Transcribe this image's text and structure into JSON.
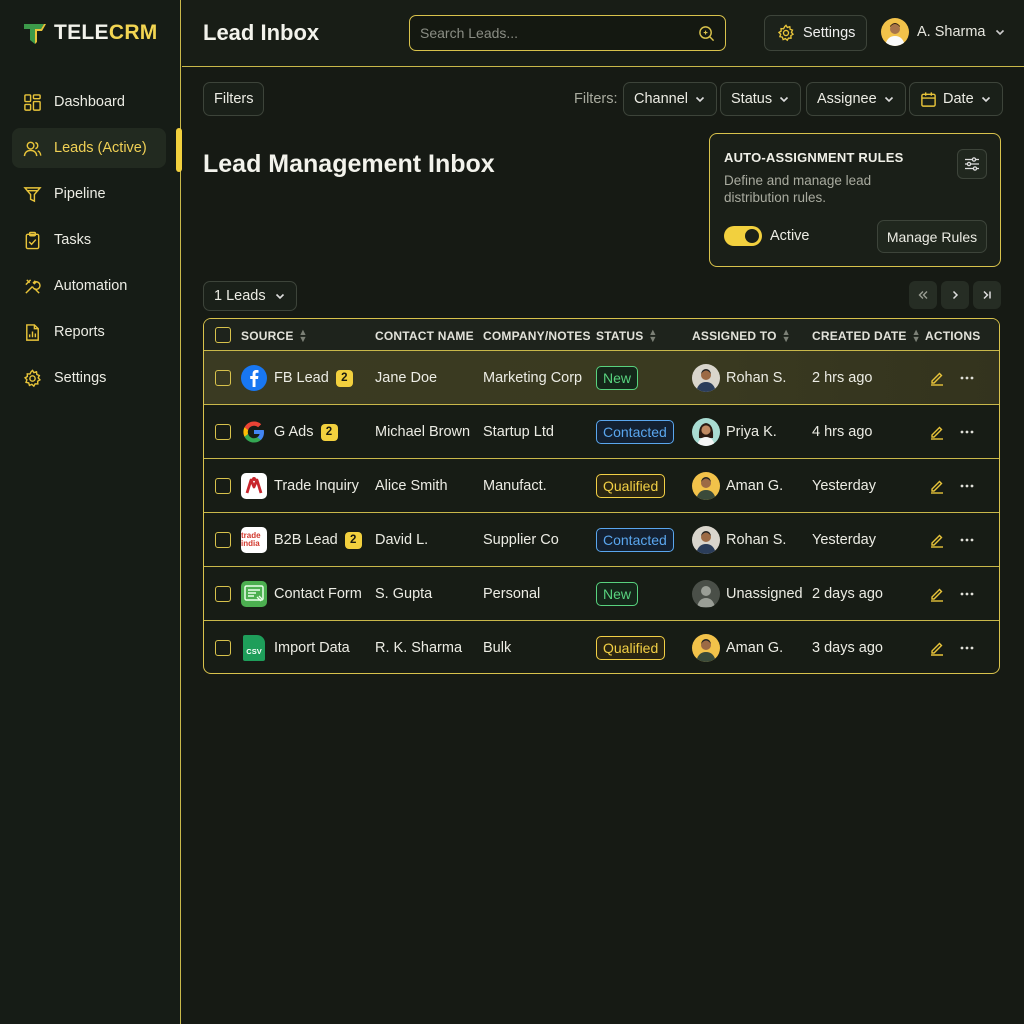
{
  "app": {
    "logo_part1": "TELE",
    "logo_part2": "CRM"
  },
  "sidebar": {
    "items": [
      {
        "label": "Dashboard",
        "icon": "grid-icon"
      },
      {
        "label": "Leads (Active)",
        "icon": "users-icon",
        "active": true
      },
      {
        "label": "Pipeline",
        "icon": "funnel-icon"
      },
      {
        "label": "Tasks",
        "icon": "clipboard-check-icon"
      },
      {
        "label": "Automation",
        "icon": "tools-icon"
      },
      {
        "label": "Reports",
        "icon": "report-chart-icon"
      },
      {
        "label": "Settings",
        "icon": "gear-icon"
      }
    ]
  },
  "header": {
    "title": "Lead Inbox",
    "search_placeholder": "Search Leads...",
    "settings_label": "Settings",
    "user_name": "A. Sharma"
  },
  "filters": {
    "button_label": "Filters",
    "label": "Filters:",
    "channel": "Channel",
    "status": "Status",
    "assignee": "Assignee",
    "date": "Date"
  },
  "main": {
    "heading": "Lead Management Inbox",
    "lead_count": "1 Leads"
  },
  "rules": {
    "title": "AUTO-ASSIGNMENT RULES",
    "description": "Define and manage lead distribution rules.",
    "toggle_label": "Active",
    "toggle_on": true,
    "manage_label": "Manage Rules"
  },
  "table": {
    "columns": [
      "SOURCE",
      "CONTACT NAME",
      "COMPANY/NOTES",
      "STATUS",
      "ASSIGNED TO",
      "CREATED DATE",
      "ACTIONS"
    ],
    "rows": [
      {
        "source": "FB Lead",
        "source_icon": "facebook-icon",
        "badge": "2",
        "contact": "Jane Doe",
        "company": "Marketing Corp",
        "status": "New",
        "assignee": "Rohan S.",
        "created": "2 hrs ago"
      },
      {
        "source": "G Ads",
        "source_icon": "google-icon",
        "badge": "2",
        "contact": "Michael Brown",
        "company": "Startup Ltd",
        "status": "Contacted",
        "assignee": "Priya K.",
        "created": "4 hrs ago"
      },
      {
        "source": "Trade Inquiry",
        "source_icon": "trade-logo-icon",
        "badge": "",
        "contact": "Alice Smith",
        "company": "Manufact.",
        "status": "Qualified",
        "assignee": "Aman G.",
        "created": "Yesterday"
      },
      {
        "source": "B2B Lead",
        "source_icon": "tradeindia-logo-icon",
        "source_logo_text": "trade india",
        "badge": "2",
        "contact": "David L.",
        "company": "Supplier Co",
        "status": "Contacted",
        "assignee": "Rohan S.",
        "created": "Yesterday"
      },
      {
        "source": "Contact Form",
        "source_icon": "form-icon",
        "badge": "",
        "contact": "S. Gupta",
        "company": "Personal",
        "status": "New",
        "assignee": "Unassigned",
        "created": "2 days ago"
      },
      {
        "source": "Import Data",
        "source_icon": "csv-file-icon",
        "source_logo_text": "CSV",
        "badge": "",
        "contact": "R. K. Sharma",
        "company": "Bulk",
        "status": "Qualified",
        "assignee": "Aman G.",
        "created": "3 days ago"
      }
    ]
  },
  "colors": {
    "accent": "#f2d03e",
    "status_new": "#58d27e",
    "status_contacted": "#5aa6ee",
    "status_qualified": "#f2cf45"
  }
}
